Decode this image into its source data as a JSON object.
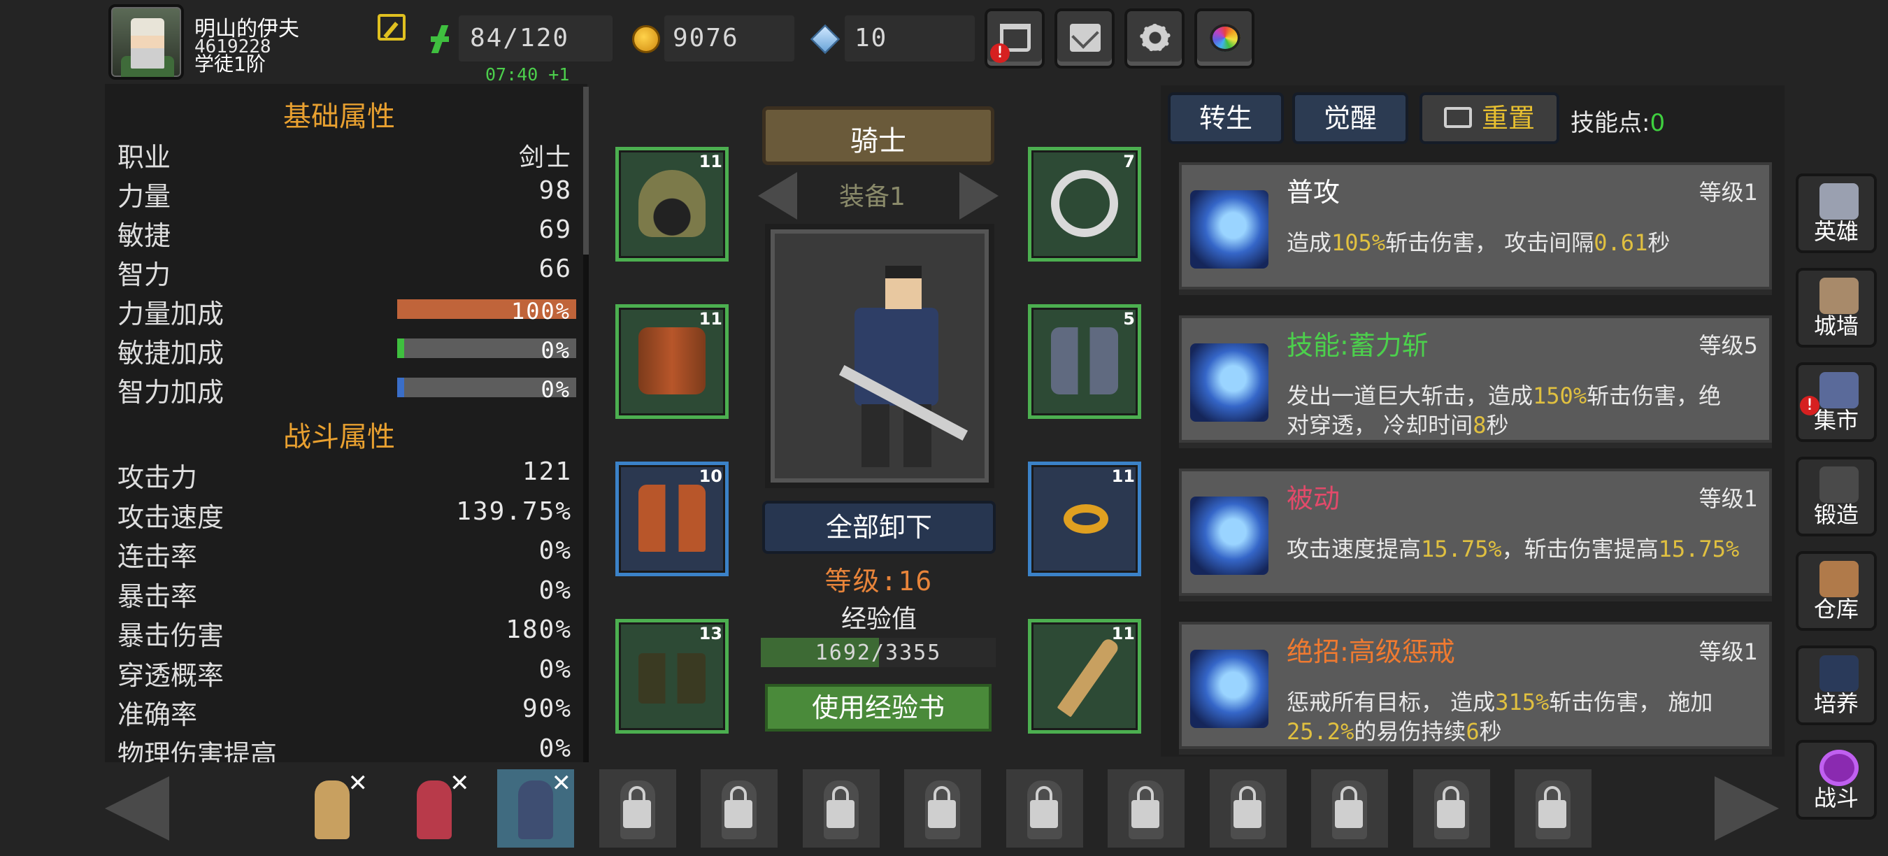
{
  "player": {
    "name": "明山的伊夫",
    "id": "4619228",
    "rank": "学徒1阶"
  },
  "resources": {
    "energy": "84/120",
    "coins": "9076",
    "gems": "10",
    "timer": "07:40 +1"
  },
  "stats": {
    "base_title": "基础属性",
    "base": [
      {
        "label": "职业",
        "value": "剑士"
      },
      {
        "label": "力量",
        "value": "98"
      },
      {
        "label": "敏捷",
        "value": "69"
      },
      {
        "label": "智力",
        "value": "66"
      }
    ],
    "bonuses": [
      {
        "label": "力量加成",
        "value": "100%",
        "fraction": 1.0,
        "color": "#c0643a"
      },
      {
        "label": "敏捷加成",
        "value": "0%",
        "fraction": 0.0,
        "color": "#3fbf3f"
      },
      {
        "label": "智力加成",
        "value": "0%",
        "fraction": 0.0,
        "color": "#3a6ec8"
      }
    ],
    "combat_title": "战斗属性",
    "combat": [
      {
        "label": "攻击力",
        "value": "121"
      },
      {
        "label": "攻击速度",
        "value": "139.75%"
      },
      {
        "label": "连击率",
        "value": "0%"
      },
      {
        "label": "暴击率",
        "value": "0%"
      },
      {
        "label": "暴击伤害",
        "value": "180%"
      },
      {
        "label": "穿透概率",
        "value": "0%"
      },
      {
        "label": "准确率",
        "value": "90%"
      },
      {
        "label": "物理伤害提高",
        "value": "0%"
      }
    ]
  },
  "equipment": {
    "class_name": "骑士",
    "set_label": "装备1",
    "slots": {
      "helmet": "11",
      "armor": "11",
      "pants": "10",
      "boots": "13",
      "amulet": "7",
      "gloves": "5",
      "ring": "11",
      "weapon": "11"
    },
    "unequip_all": "全部卸下",
    "level": "等级:16",
    "exp_label": "经验值",
    "exp_text": "1692/3355",
    "exp_fraction": 0.504,
    "use_exp_book": "使用经验书"
  },
  "skills_panel": {
    "rebirth": "转生",
    "awaken": "觉醒",
    "reset": "重置",
    "points_label": "技能点:",
    "points": "0"
  },
  "skills": [
    {
      "name": "普攻",
      "name_color": "#ffffff",
      "level": "等级1",
      "desc": [
        {
          "t": "造成"
        },
        {
          "t": "105%",
          "hl": true
        },
        {
          "t": "斩击伤害， 攻击间隔"
        },
        {
          "t": "0.61",
          "hl": true
        },
        {
          "t": "秒"
        }
      ]
    },
    {
      "name": "技能:蓄力斩",
      "name_color": "#4cd04c",
      "level": "等级5",
      "desc": [
        {
          "t": "发出一道巨大斩击，造成"
        },
        {
          "t": "150%",
          "hl": true
        },
        {
          "t": "斩击伤害，绝对穿透， 冷却时间"
        },
        {
          "t": "8",
          "hl": true
        },
        {
          "t": "秒"
        }
      ]
    },
    {
      "name": "被动",
      "name_color": "#e24a6a",
      "level": "等级1",
      "desc": [
        {
          "t": "攻击速度提高"
        },
        {
          "t": "15.75%",
          "hl": true
        },
        {
          "t": "，斩击伤害提高"
        },
        {
          "t": "15.75%",
          "hl": true
        }
      ]
    },
    {
      "name": "绝招:高级惩戒",
      "name_color": "#f07a30",
      "level": "等级1",
      "desc": [
        {
          "t": "惩戒所有目标， 造成"
        },
        {
          "t": "315%",
          "hl": true
        },
        {
          "t": "斩击伤害， 施加"
        },
        {
          "t": "25.2%",
          "hl": true
        },
        {
          "t": "的易伤持续"
        },
        {
          "t": "6",
          "hl": true
        },
        {
          "t": "秒"
        }
      ]
    }
  ],
  "side_nav": [
    {
      "label": "英雄",
      "icon": "helmet-icon",
      "alert": false
    },
    {
      "label": "城墙",
      "icon": "castle-icon",
      "alert": false
    },
    {
      "label": "集市",
      "icon": "market-icon",
      "alert": true
    },
    {
      "label": "锻造",
      "icon": "anvil-icon",
      "alert": false
    },
    {
      "label": "仓库",
      "icon": "chest-icon",
      "alert": false
    },
    {
      "label": "培养",
      "icon": "chalice-icon",
      "alert": false
    },
    {
      "label": "战斗",
      "icon": "portal-icon",
      "alert": false
    }
  ],
  "roster": [
    {
      "state": "owned",
      "color": "#c8a060"
    },
    {
      "state": "owned",
      "color": "#b83a4a"
    },
    {
      "state": "selected",
      "color": "#3e4e72"
    },
    {
      "state": "locked"
    },
    {
      "state": "locked"
    },
    {
      "state": "locked"
    },
    {
      "state": "locked"
    },
    {
      "state": "locked"
    },
    {
      "state": "locked"
    },
    {
      "state": "locked"
    },
    {
      "state": "locked"
    },
    {
      "state": "locked"
    },
    {
      "state": "locked"
    }
  ],
  "roster_remove_glyph": "✕"
}
